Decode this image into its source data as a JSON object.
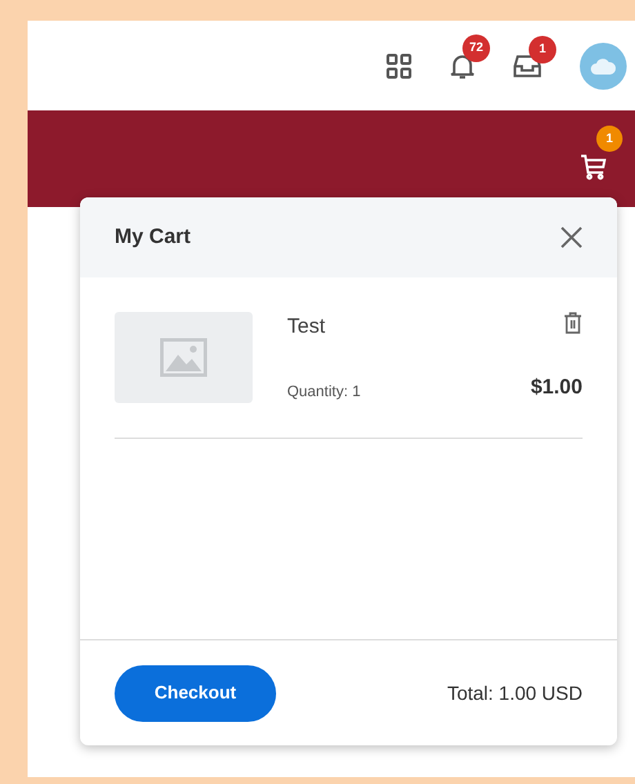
{
  "top_bar": {
    "notifications_badge": "72",
    "inbox_badge": "1"
  },
  "nav_bar": {
    "cart_badge": "1"
  },
  "cart": {
    "title": "My Cart",
    "items": [
      {
        "name": "Test",
        "quantity": "Quantity: 1",
        "price": "$1.00"
      }
    ],
    "checkout_button": "Checkout",
    "total": "Total: 1.00 USD"
  }
}
